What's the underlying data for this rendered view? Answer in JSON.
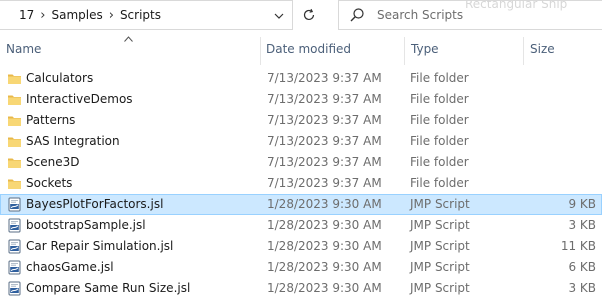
{
  "address_bar": {
    "breadcrumbs": [
      "17",
      "Samples",
      "Scripts"
    ],
    "separator": "›"
  },
  "search": {
    "placeholder": "Search Scripts"
  },
  "overlay": {
    "snip_hint": "Rectangular Snip"
  },
  "columns": {
    "name": "Name",
    "date": "Date modified",
    "type": "Type",
    "size": "Size"
  },
  "colors": {
    "folder": "#f8d775",
    "selected_bg": "#cce8ff",
    "selected_border": "#99d1ff",
    "header_text": "#4c607a"
  },
  "files": [
    {
      "name": "Calculators",
      "date": "7/13/2023 9:37 AM",
      "type": "File folder",
      "size": "",
      "icon": "folder-icon"
    },
    {
      "name": "InteractiveDemos",
      "date": "7/13/2023 9:37 AM",
      "type": "File folder",
      "size": "",
      "icon": "folder-icon"
    },
    {
      "name": "Patterns",
      "date": "7/13/2023 9:37 AM",
      "type": "File folder",
      "size": "",
      "icon": "folder-icon"
    },
    {
      "name": "SAS Integration",
      "date": "7/13/2023 9:37 AM",
      "type": "File folder",
      "size": "",
      "icon": "folder-icon"
    },
    {
      "name": "Scene3D",
      "date": "7/13/2023 9:37 AM",
      "type": "File folder",
      "size": "",
      "icon": "folder-icon"
    },
    {
      "name": "Sockets",
      "date": "7/13/2023 9:37 AM",
      "type": "File folder",
      "size": "",
      "icon": "folder-icon"
    },
    {
      "name": "BayesPlotForFactors.jsl",
      "date": "1/28/2023 9:30 AM",
      "type": "JMP Script",
      "size": "9 KB",
      "icon": "jsl-file-icon",
      "selected": true
    },
    {
      "name": "bootstrapSample.jsl",
      "date": "1/28/2023 9:30 AM",
      "type": "JMP Script",
      "size": "3 KB",
      "icon": "jsl-file-icon"
    },
    {
      "name": "Car Repair Simulation.jsl",
      "date": "1/28/2023 9:30 AM",
      "type": "JMP Script",
      "size": "11 KB",
      "icon": "jsl-file-icon"
    },
    {
      "name": "chaosGame.jsl",
      "date": "1/28/2023 9:30 AM",
      "type": "JMP Script",
      "size": "6 KB",
      "icon": "jsl-file-icon"
    },
    {
      "name": "Compare Same Run Size.jsl",
      "date": "1/28/2023 9:30 AM",
      "type": "JMP Script",
      "size": "3 KB",
      "icon": "jsl-file-icon"
    }
  ]
}
